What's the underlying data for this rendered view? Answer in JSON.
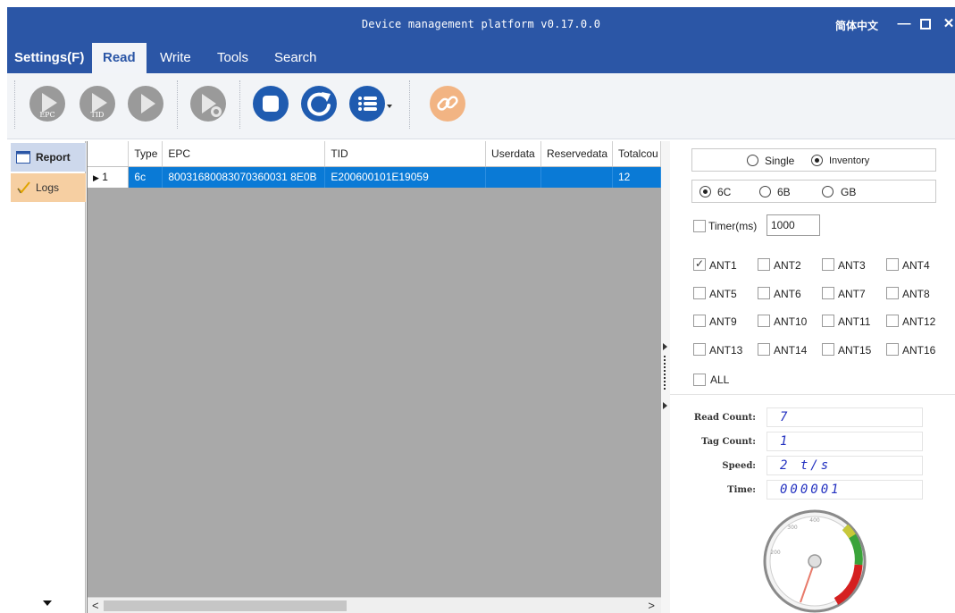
{
  "window": {
    "title": "Device management platform v0.17.0.0",
    "language": "简体中文",
    "minimize": "—",
    "maximize": "☐",
    "close": "✕"
  },
  "menu": {
    "settings": "Settings(F)",
    "tabs": [
      "Read",
      "Write",
      "Tools",
      "Search"
    ],
    "active_tab": "Read"
  },
  "toolbar": {
    "buttons": [
      {
        "icon": "epc-read-icon",
        "label": "EPC",
        "enabled": false
      },
      {
        "icon": "tid-read-icon",
        "label": "TID",
        "enabled": false
      },
      {
        "icon": "play-icon",
        "label": "",
        "enabled": false
      },
      {
        "icon": "play-timer-icon",
        "label": "",
        "enabled": false
      },
      {
        "icon": "stop-icon",
        "label": "",
        "enabled": true
      },
      {
        "icon": "refresh-icon",
        "label": "",
        "enabled": true
      },
      {
        "icon": "list-menu-icon",
        "label": "",
        "enabled": true
      },
      {
        "icon": "link-icon",
        "label": "",
        "enabled": true
      }
    ],
    "colors": {
      "disabled": "#9a9a9a",
      "enabled": "#1f5bb0",
      "link": "#f2b483"
    }
  },
  "sidebar": {
    "items": [
      {
        "label": "Report",
        "icon": "report-window-icon",
        "selected": true
      },
      {
        "label": "Logs",
        "icon": "logs-pen-icon",
        "selected": false
      }
    ]
  },
  "grid": {
    "columns": [
      "Type",
      "EPC",
      "TID",
      "Userdata",
      "Reservedata",
      "Totalcou"
    ],
    "rows": [
      {
        "index": "1",
        "type": "6c",
        "epc": "80031680083070360031 8E0B",
        "tid": "E200600101E19059",
        "userdata": "",
        "reservedata": "",
        "total": "12"
      }
    ],
    "scroll_left": "<",
    "scroll_right": ">"
  },
  "settings_panel": {
    "mode_options": [
      "Single",
      "Inventory"
    ],
    "mode_selected": "Inventory",
    "protocol_options": [
      "6C",
      "6B",
      "GB"
    ],
    "protocol_selected": "6C",
    "timer_label": "Timer(ms)",
    "timer_value": "1000",
    "timer_checked": false,
    "antennas": [
      {
        "label": "ANT1",
        "checked": true
      },
      {
        "label": "ANT2",
        "checked": false
      },
      {
        "label": "ANT3",
        "checked": false
      },
      {
        "label": "ANT4",
        "checked": false
      },
      {
        "label": "ANT5",
        "checked": false
      },
      {
        "label": "ANT6",
        "checked": false
      },
      {
        "label": "ANT7",
        "checked": false
      },
      {
        "label": "ANT8",
        "checked": false
      },
      {
        "label": "ANT9",
        "checked": false
      },
      {
        "label": "ANT10",
        "checked": false
      },
      {
        "label": "ANT11",
        "checked": false
      },
      {
        "label": "ANT12",
        "checked": false
      },
      {
        "label": "ANT13",
        "checked": false
      },
      {
        "label": "ANT14",
        "checked": false
      },
      {
        "label": "ANT15",
        "checked": false
      },
      {
        "label": "ANT16",
        "checked": false
      }
    ],
    "all_label": "ALL",
    "all_checked": false
  },
  "stats": {
    "read_count_label": "Read Count:",
    "read_count": "7",
    "tag_count_label": "Tag Count:",
    "tag_count": "1",
    "speed_label": "Speed:",
    "speed": "2 t/s",
    "time_label": "Time:",
    "time": "000001",
    "gauge_ticks": [
      "400",
      "300",
      "200"
    ],
    "gauge_value": 2
  }
}
